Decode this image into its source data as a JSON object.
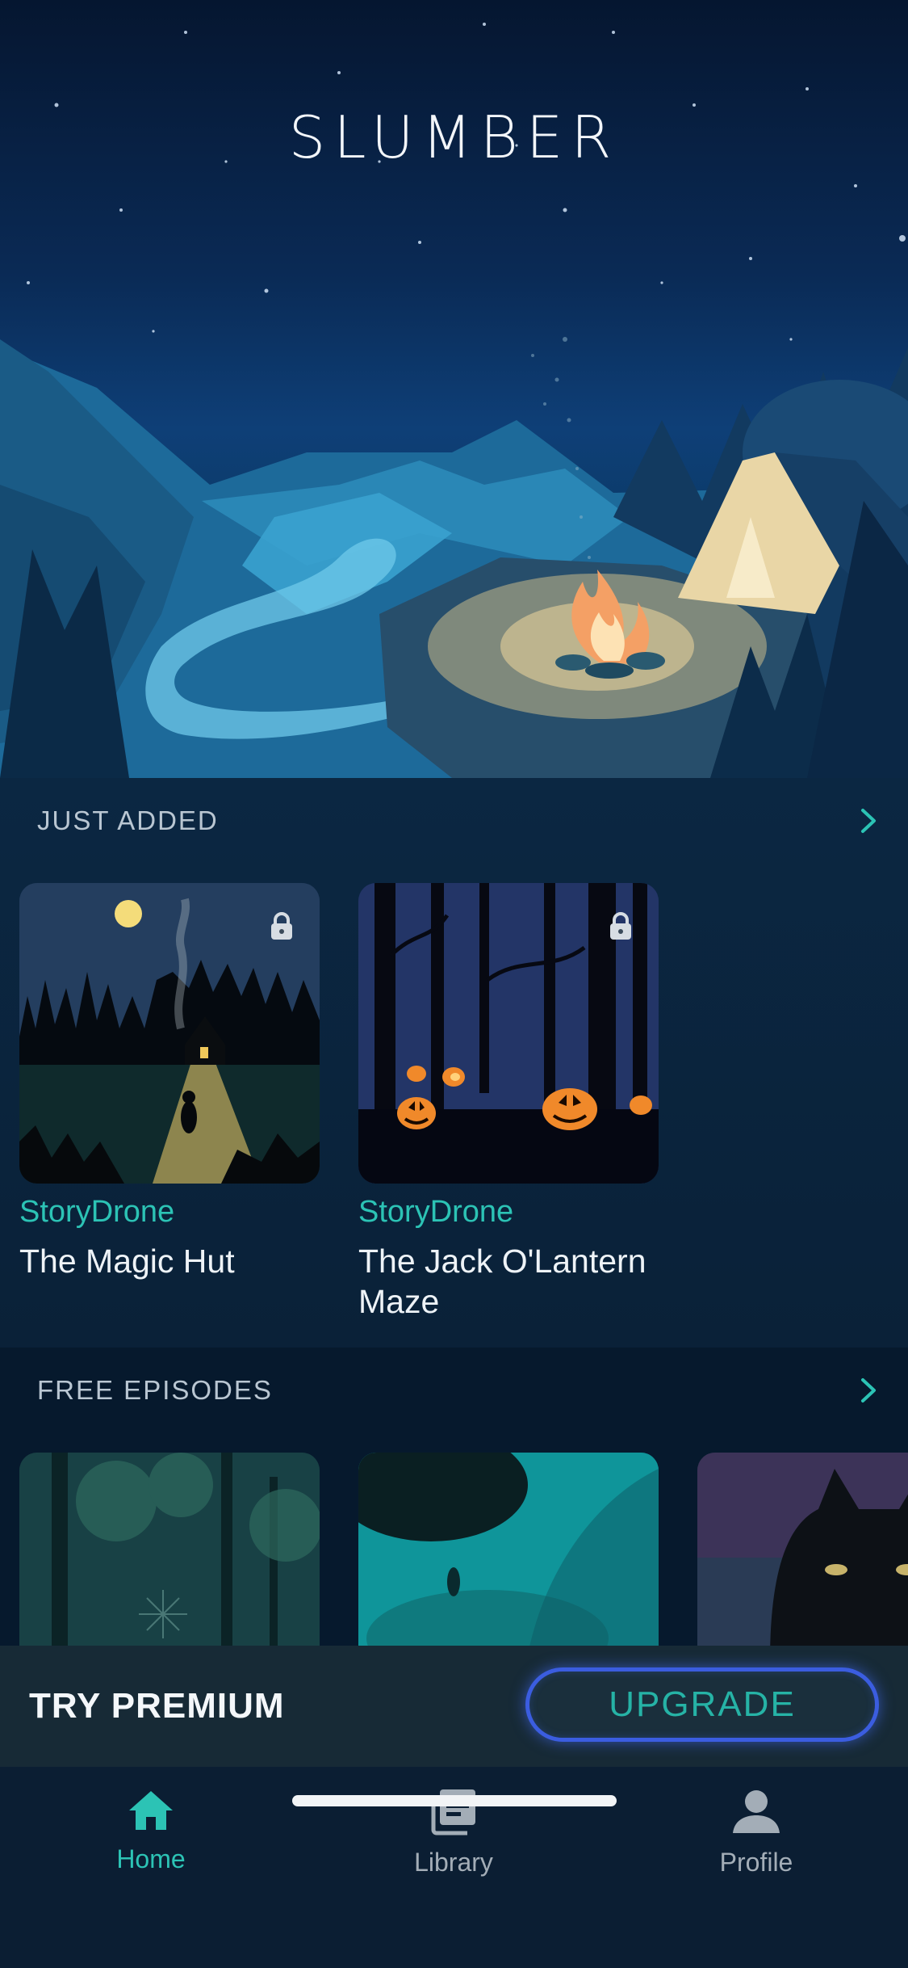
{
  "app": {
    "title": "SLUMBER"
  },
  "sections": {
    "just_added": {
      "header": "JUST ADDED",
      "items": [
        {
          "author": "StoryDrone",
          "title": "The Magic Hut",
          "locked": true
        },
        {
          "author": "StoryDrone",
          "title": "The Jack O'Lantern Maze",
          "locked": true
        }
      ]
    },
    "free_episodes": {
      "header": "FREE EPISODES"
    }
  },
  "premium": {
    "label": "TRY PREMIUM",
    "button": "UPGRADE"
  },
  "tabs": [
    {
      "label": "Home",
      "icon": "home-icon",
      "active": true
    },
    {
      "label": "Library",
      "icon": "library-icon",
      "active": false
    },
    {
      "label": "Profile",
      "icon": "profile-icon",
      "active": false
    }
  ],
  "colors": {
    "accent": "#2cc3b5",
    "upgrade_border": "#3b5de0",
    "background": "#061a2e"
  }
}
